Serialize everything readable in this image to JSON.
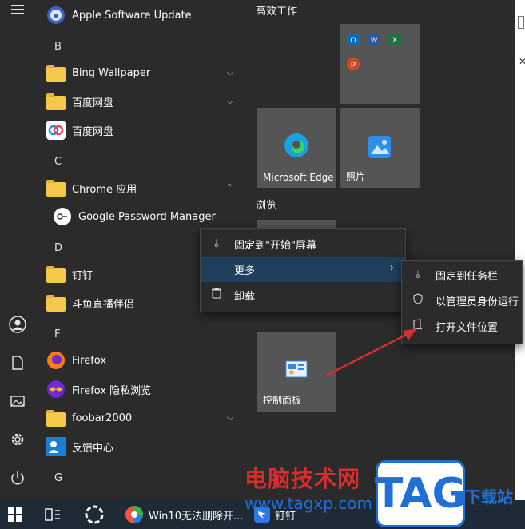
{
  "app_list": {
    "items": [
      {
        "kind": "app",
        "label": "Apple Software Update",
        "icon": "apple-update-icon"
      },
      {
        "kind": "letter",
        "label": "B"
      },
      {
        "kind": "folder",
        "label": "Bing Wallpaper",
        "chevron": "down"
      },
      {
        "kind": "folder",
        "label": "百度网盘",
        "chevron": "down"
      },
      {
        "kind": "app",
        "label": "百度网盘",
        "icon": "baidu-netdisk-icon"
      },
      {
        "kind": "letter",
        "label": "C"
      },
      {
        "kind": "folder",
        "label": "Chrome 应用",
        "chevron": "up"
      },
      {
        "kind": "app",
        "label": "Google Password Manager",
        "icon": "google-password-icon",
        "indent": true
      },
      {
        "kind": "letter",
        "label": "D"
      },
      {
        "kind": "folder",
        "label": "钉钉"
      },
      {
        "kind": "folder",
        "label": "斗鱼直播伴侣"
      },
      {
        "kind": "letter",
        "label": "F"
      },
      {
        "kind": "app",
        "label": "Firefox",
        "icon": "firefox-icon"
      },
      {
        "kind": "app",
        "label": "Firefox 隐私浏览",
        "icon": "firefox-private-icon"
      },
      {
        "kind": "folder",
        "label": "foobar2000",
        "chevron": "down"
      },
      {
        "kind": "app",
        "label": "反馈中心",
        "icon": "feedback-hub-icon"
      },
      {
        "kind": "letter",
        "label": "G"
      }
    ]
  },
  "tiles": {
    "group_efficient": "高效工作",
    "group_browse": "浏览",
    "edge": "Microsoft Edge",
    "photos": "照片",
    "control_panel": "控制面板"
  },
  "context_menu": {
    "pin_start": "固定到\"开始\"屏幕",
    "more": "更多",
    "uninstall": "卸载"
  },
  "submenu": {
    "pin_taskbar": "固定到任务栏",
    "run_admin": "以管理员身份运行",
    "open_location": "打开文件位置"
  },
  "taskbar": {
    "window1": "Win10无法删除开...",
    "window2": "钉钉"
  },
  "watermark": {
    "site_cn": "电脑技术网",
    "url": "www.tagxp.com",
    "logo": "TAG",
    "right": "下载站"
  },
  "colors": {
    "menu_highlight": "#1f3f5c",
    "arrow": "#d42e2e",
    "folder": "#f5c74a"
  }
}
